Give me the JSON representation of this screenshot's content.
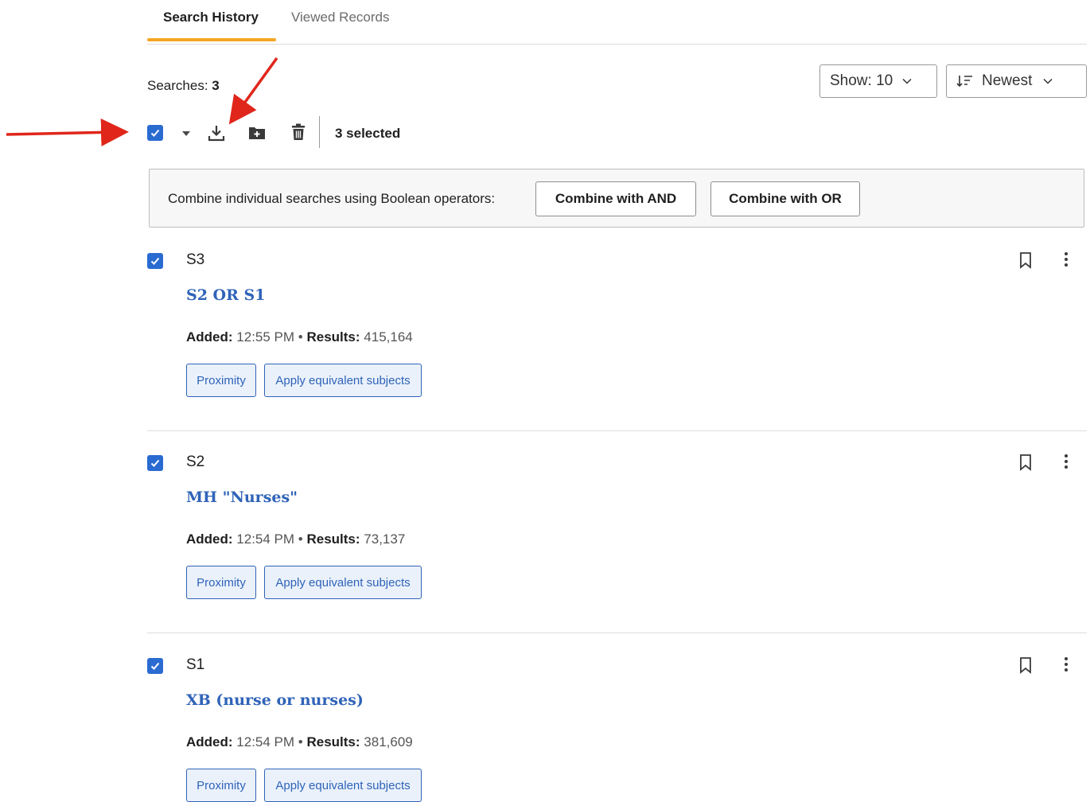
{
  "tabs": [
    {
      "label": "Search History",
      "active": true
    },
    {
      "label": "Viewed Records",
      "active": false
    }
  ],
  "summary": {
    "searches_label": "Searches:",
    "searches_count": "3"
  },
  "show_dropdown": {
    "label": "Show: 10"
  },
  "sort_dropdown": {
    "label": "Newest"
  },
  "toolbar": {
    "selected_text": "3 selected",
    "icons": [
      "checkbox-checked-icon",
      "caret-down-icon",
      "download-icon",
      "add-to-folder-icon",
      "trash-icon"
    ]
  },
  "combine": {
    "text": "Combine individual searches using Boolean operators:",
    "and_label": "Combine with AND",
    "or_label": "Combine with OR"
  },
  "searches": [
    {
      "id": "S3",
      "query": "S2 OR S1",
      "added_label": "Added:",
      "added_time": "12:55 PM",
      "results_label": "Results:",
      "results": "415,164",
      "tag1": "Proximity",
      "tag2": "Apply equivalent subjects"
    },
    {
      "id": "S2",
      "query": "MH \"Nurses\"",
      "added_label": "Added:",
      "added_time": "12:54 PM",
      "results_label": "Results:",
      "results": "73,137",
      "tag1": "Proximity",
      "tag2": "Apply equivalent subjects"
    },
    {
      "id": "S1",
      "query": "XB (nurse or nurses)",
      "added_label": "Added:",
      "added_time": "12:54 PM",
      "results_label": "Results:",
      "results": "381,609",
      "tag1": "Proximity",
      "tag2": "Apply equivalent subjects"
    }
  ],
  "colors": {
    "accent": "#2a6bd1",
    "tab_underline": "#f5a623",
    "link": "#2f63b8",
    "annotation": "#e0261b"
  }
}
